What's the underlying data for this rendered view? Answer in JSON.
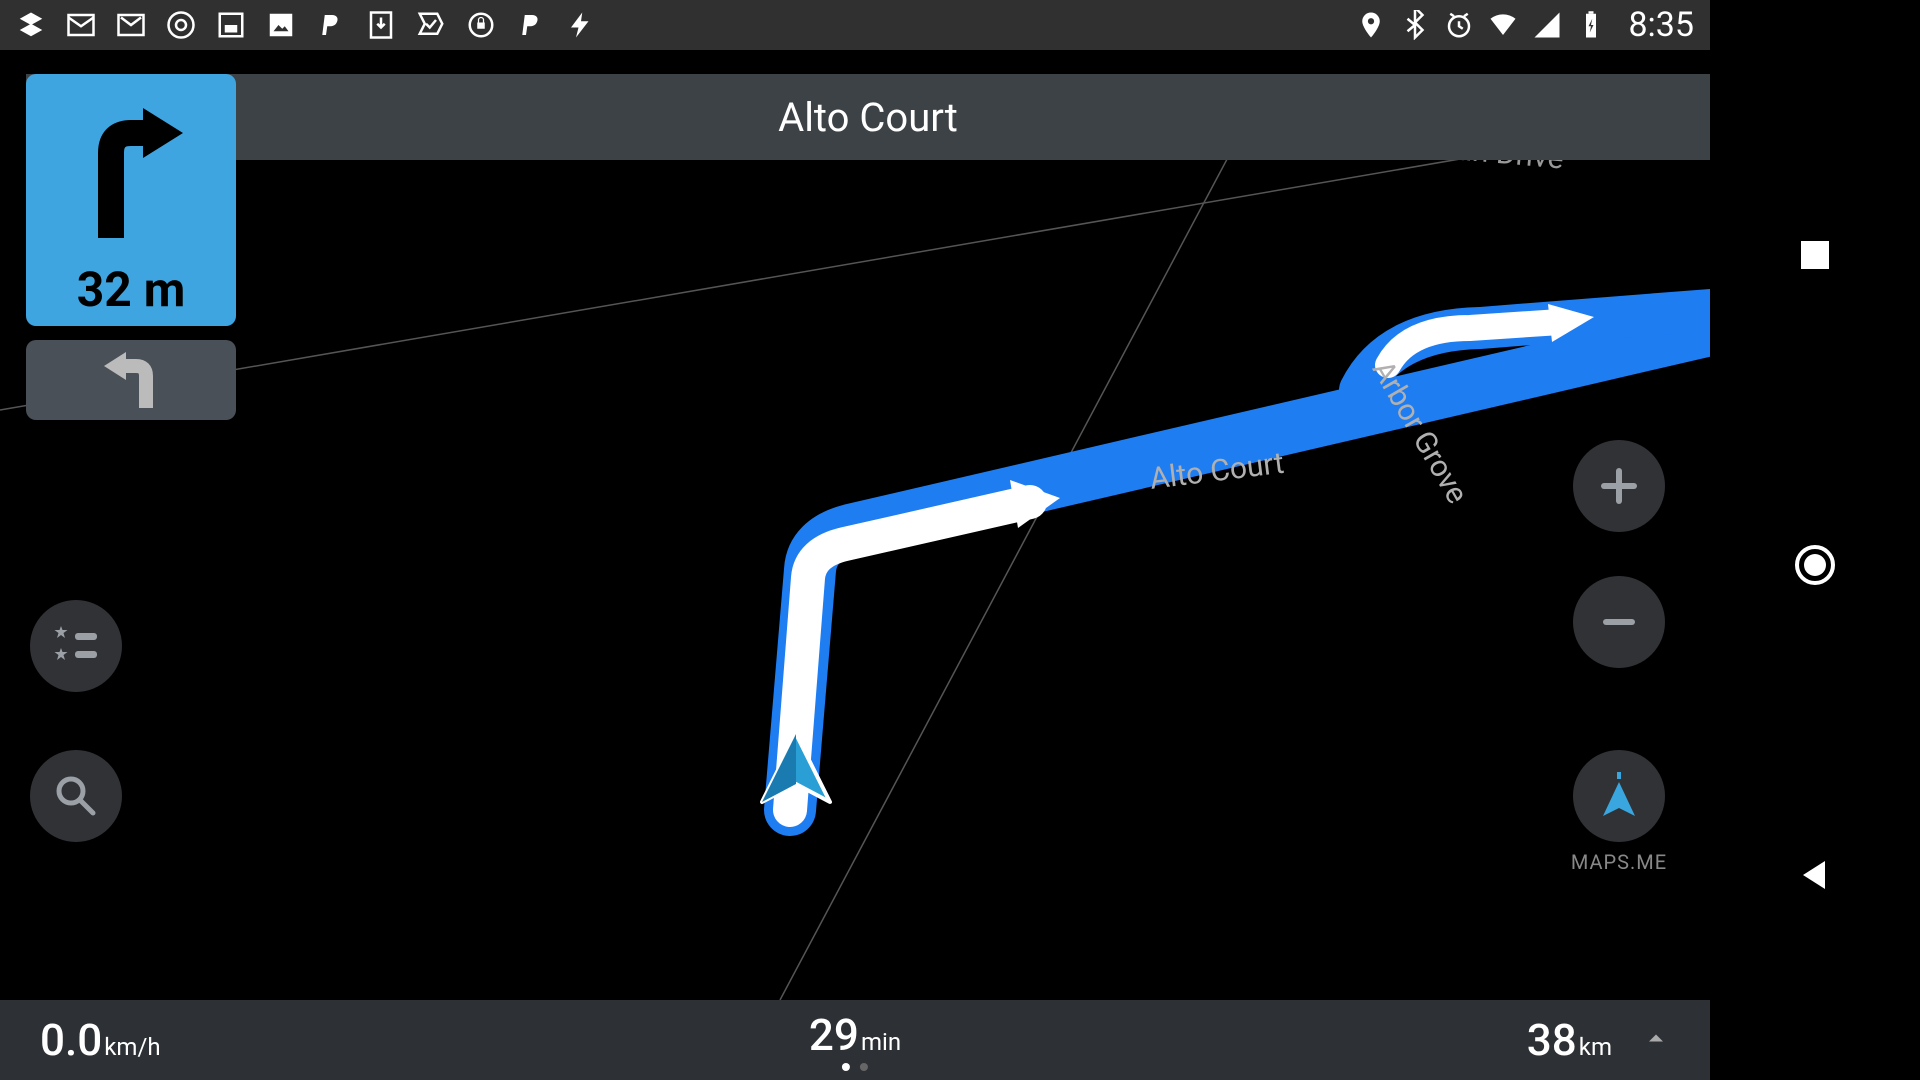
{
  "status": {
    "time": "8:35",
    "left_icons": [
      "layers",
      "mail",
      "gmail",
      "chrome",
      "square",
      "image",
      "paypal",
      "download",
      "check-shield",
      "shield-lock",
      "paypal",
      "lightning"
    ],
    "right_icons": [
      "location",
      "bluetooth",
      "alarm",
      "wifi",
      "cell",
      "battery-charging"
    ]
  },
  "header": {
    "street": "Alto Court"
  },
  "turn_primary": {
    "distance": "32 m",
    "direction": "turn-right"
  },
  "turn_secondary": {
    "direction": "turn-left"
  },
  "buttons": {
    "bookmarks": "bookmarks-list",
    "search": "search",
    "zoom_in": "+",
    "zoom_out": "−",
    "compass": "compass",
    "compass_label": "MAPS.ME"
  },
  "bottom": {
    "speed_value": "0.0",
    "speed_unit": "km/h",
    "time_value": "29",
    "time_unit": "min",
    "dist_value": "38",
    "dist_unit": "km"
  },
  "map_labels": {
    "alto": "Alto Court",
    "arbor": "Arbor Grove",
    "drive": "man Drive"
  }
}
